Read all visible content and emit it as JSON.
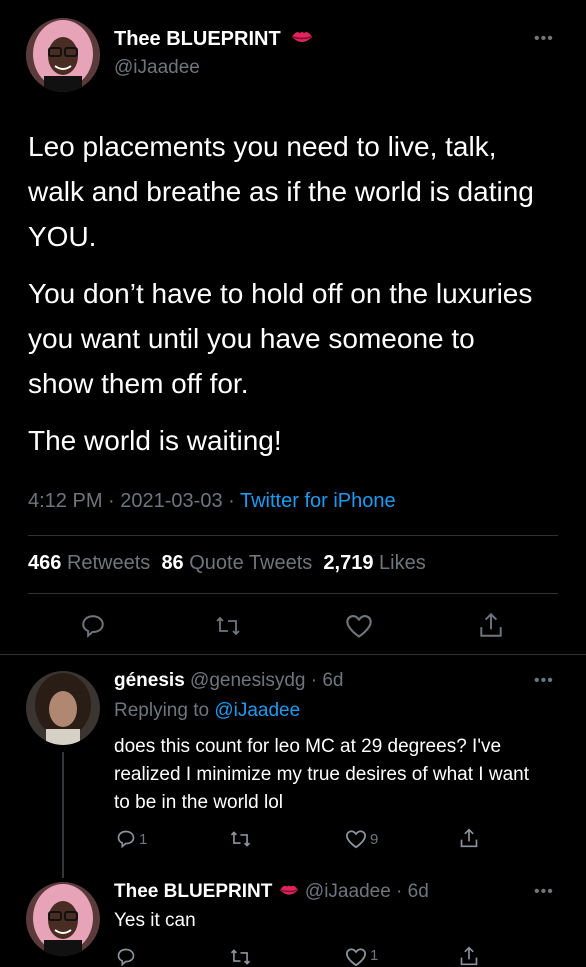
{
  "main_tweet": {
    "display_name": "Thee BLUEPRINT",
    "handle": "@iJaadee",
    "paragraphs": [
      "Leo placements you need to live, talk, walk and breathe as if the world is dating YOU.",
      "You don’t have to hold off on the luxuries you want until you have someone to show them off for.",
      "The world is waiting!"
    ],
    "time": "4:12 PM",
    "date": "2021-03-03",
    "source": "Twitter for iPhone",
    "retweets_count": "466",
    "retweets_label": "Retweets",
    "quote_count": "86",
    "quote_label": "Quote Tweets",
    "likes_count": "2,719",
    "likes_label": "Likes"
  },
  "reply_1": {
    "display_name": "génesis",
    "handle": "@genesisydg",
    "age": "6d",
    "replying_prefix": "Replying to",
    "replying_handle": "@iJaadee",
    "text": "does this count for leo MC at 29 degrees? I've realized I minimize my true desires of what I want to be in the world lol",
    "reply_count": "1",
    "like_count": "9"
  },
  "reply_2": {
    "display_name": "Thee BLUEPRINT",
    "handle": "@iJaadee",
    "age": "6d",
    "text": "Yes it can",
    "like_count": "1"
  },
  "colors": {
    "background": "#000000",
    "text": "#ffffff",
    "secondary": "#6e767d",
    "link": "#1d9bf0",
    "badge": "#e0245e"
  },
  "icons": [
    "lips-emoji",
    "more-icon",
    "reply-icon",
    "retweet-icon",
    "like-icon",
    "share-icon"
  ]
}
